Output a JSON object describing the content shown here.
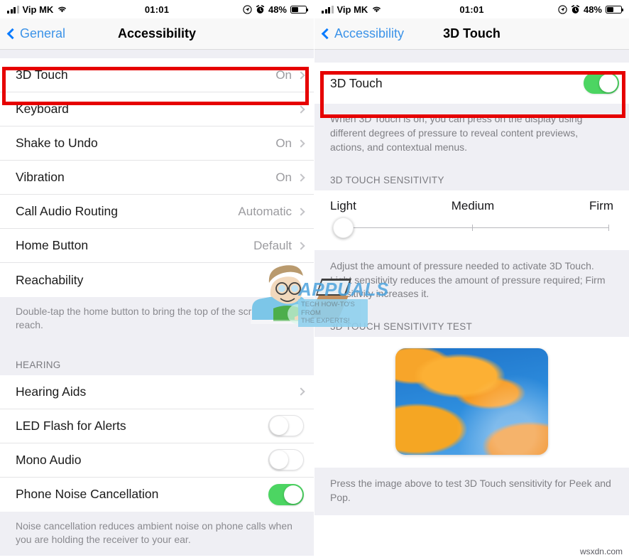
{
  "status_bar": {
    "carrier": "Vip MK",
    "time": "01:01",
    "battery_percent": "48%",
    "signal_icon": "signal-bars-icon",
    "wifi_icon": "wifi-icon",
    "location_icon": "location-arrow-icon",
    "alarm_icon": "alarm-clock-icon",
    "battery_icon": "battery-icon"
  },
  "left_screen": {
    "nav": {
      "back_label": "General",
      "title": "Accessibility"
    },
    "rows": [
      {
        "label": "3D Touch",
        "value": "On",
        "accessory": "chevron",
        "highlighted": true
      },
      {
        "label": "Keyboard",
        "value": "",
        "accessory": "chevron"
      },
      {
        "label": "Shake to Undo",
        "value": "On",
        "accessory": "chevron"
      },
      {
        "label": "Vibration",
        "value": "On",
        "accessory": "chevron"
      },
      {
        "label": "Call Audio Routing",
        "value": "Automatic",
        "accessory": "chevron"
      },
      {
        "label": "Home Button",
        "value": "Default",
        "accessory": "chevron"
      },
      {
        "label": "Reachability",
        "value": "",
        "accessory": "none"
      }
    ],
    "footnote_reachability": "Double-tap the home button to bring the top of the screen into reach.",
    "hearing_header": "HEARING",
    "hearing_rows": [
      {
        "label": "Hearing Aids",
        "accessory": "chevron",
        "toggle": null
      },
      {
        "label": "LED Flash for Alerts",
        "accessory": "toggle",
        "toggle": "off"
      },
      {
        "label": "Mono Audio",
        "accessory": "toggle",
        "toggle": "off"
      },
      {
        "label": "Phone Noise Cancellation",
        "accessory": "toggle",
        "toggle": "on"
      }
    ],
    "footnote_noise": "Noise cancellation reduces ambient noise on phone calls when you are holding the receiver to your ear."
  },
  "right_screen": {
    "nav": {
      "back_label": "Accessibility",
      "title": "3D Touch"
    },
    "toggle_row": {
      "label": "3D Touch",
      "toggle": "on",
      "highlighted": true
    },
    "description": "When 3D Touch is on, you can press on the display using different degrees of pressure to reveal content previews, actions, and contextual menus.",
    "sensitivity_header": "3D TOUCH SENSITIVITY",
    "slider": {
      "labels": [
        "Light",
        "Medium",
        "Firm"
      ],
      "value_label": "Light",
      "position_percent": 0
    },
    "sensitivity_footnote": "Adjust the amount of pressure needed to activate 3D Touch. Light sensitivity reduces the amount of pressure required; Firm sensitivity increases it.",
    "test_header": "3D TOUCH SENSITIVITY TEST",
    "test_image_alt": "orange-poppy-flowers-photo",
    "test_footnote": "Press the image above to test 3D Touch sensitivity for Peek and Pop."
  },
  "watermarks": {
    "brand": "APPUALS",
    "brand_tagline_line1": "TECH HOW-TO'S FROM",
    "brand_tagline_line2": "THE EXPERTS!",
    "corner": "wsxdn.com"
  },
  "colors": {
    "accent_blue": "#3c93e8",
    "toggle_green": "#4cd562",
    "highlight_red": "#e60000",
    "group_bg": "#efeff4"
  }
}
